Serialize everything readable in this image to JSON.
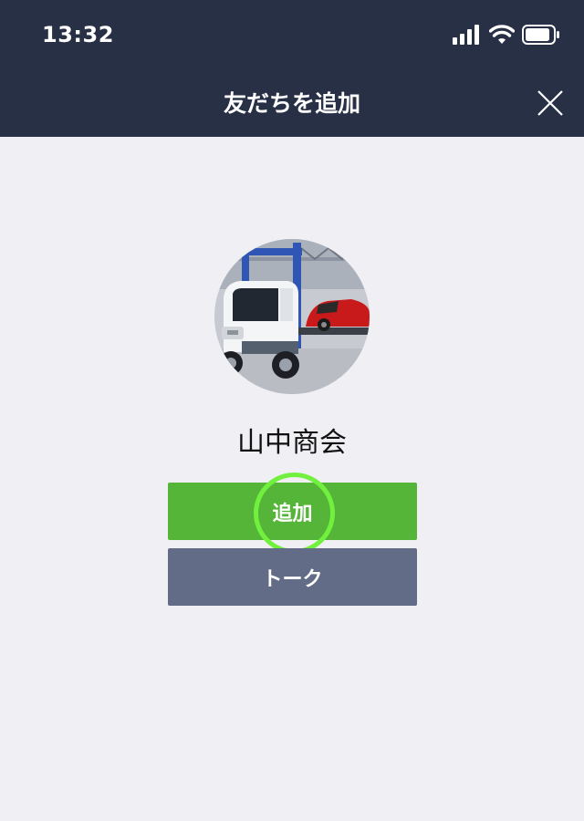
{
  "status_bar": {
    "time": "13:32",
    "icons": [
      "signal-bars-icon",
      "wifi-icon",
      "battery-icon"
    ]
  },
  "header": {
    "title": "友だちを追加",
    "close_icon": "close-icon"
  },
  "profile": {
    "name": "山中商会",
    "avatar": "tow-truck-with-red-car-photo"
  },
  "actions": {
    "add_label": "追加",
    "talk_label": "トーク"
  },
  "colors": {
    "header_bg": "#283046",
    "page_bg": "#efeff4",
    "add_button": "#55b539",
    "talk_button": "#636c87",
    "tap_indicator": "#71f03e"
  }
}
